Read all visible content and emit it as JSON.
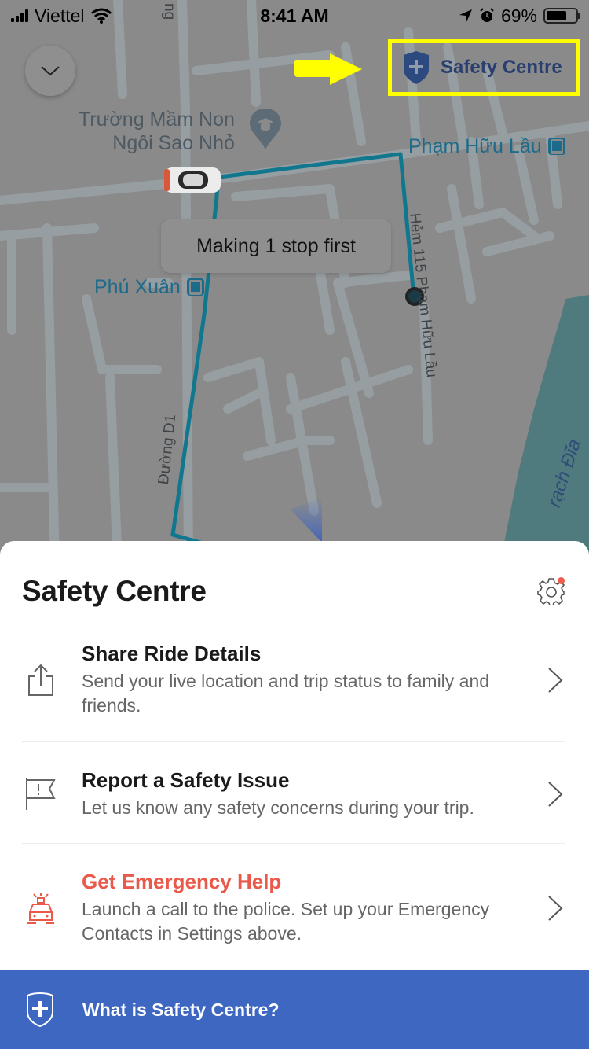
{
  "status_bar": {
    "carrier": "Viettel",
    "time": "8:41 AM",
    "battery_percent_label": "69%",
    "battery_level": 0.69
  },
  "map": {
    "poi": {
      "line1": "Trường Mầm Non",
      "line2": "Ngôi Sao Nhỏ",
      "icon": "school-pin-icon"
    },
    "bus_stops": [
      {
        "label": "Phạm Hữu Lầu"
      },
      {
        "label": "Phú Xuân"
      }
    ],
    "streets": {
      "top_fragment": "ng",
      "hem": "Hẻm 115 Phạm Hữu Lầu",
      "hem_lower": "m Hữu Lầu",
      "duong_d1": "Đường D1"
    },
    "water": "rạch Đĩa",
    "route_color": "#11778f",
    "water_color": "#4f7a7e",
    "tooltip": "Making 1 stop first"
  },
  "overlay": {
    "collapse_icon": "chevron-down-icon",
    "safety_button_label": "Safety Centre",
    "highlight_color": "#ffff00"
  },
  "sheet": {
    "title": "Safety Centre",
    "options": [
      {
        "icon": "share-icon",
        "title": "Share Ride Details",
        "description": "Send your live location and trip status to family and friends."
      },
      {
        "icon": "flag-alert-icon",
        "title": "Report a Safety Issue",
        "description": "Let us know any safety concerns during your trip."
      },
      {
        "icon": "police-car-icon",
        "title": "Get Emergency Help",
        "description": "Launch a call to the police. Set up your Emergency Contacts in Settings above.",
        "accent": "#ea5a4a"
      }
    ],
    "info_bar_label": "What is Safety Centre?",
    "info_bar_color": "#3e67c2"
  }
}
